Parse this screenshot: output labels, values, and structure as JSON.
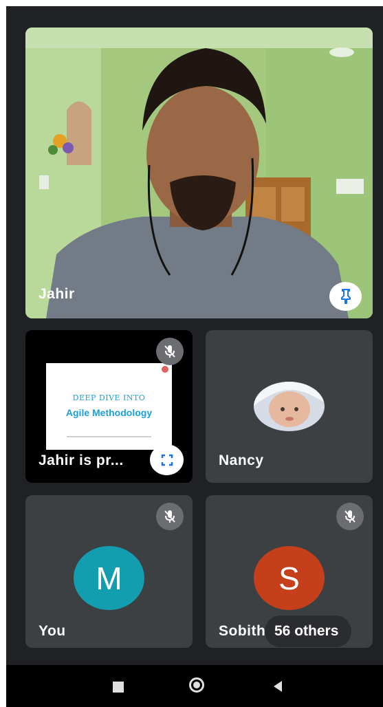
{
  "main_tile": {
    "name": "Jahir"
  },
  "presentation_tile": {
    "name": "Jahir is pr...",
    "slide_title": "DEEP DIVE INTO",
    "slide_subtitle": "Agile Methodology"
  },
  "nancy_tile": {
    "name": "Nancy"
  },
  "you_tile": {
    "name": "You",
    "avatar_letter": "M",
    "avatar_color": "#129eaf"
  },
  "others_tile": {
    "name": "Sobith",
    "avatar_letter": "S",
    "avatar_color": "#c5401a",
    "others_badge": "56 others"
  },
  "colors": {
    "background": "#202124",
    "tile": "#3c4043",
    "accent_blue": "#1a73e8"
  }
}
